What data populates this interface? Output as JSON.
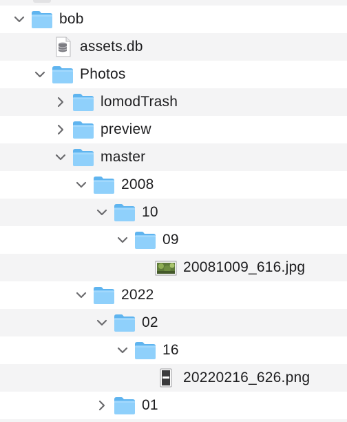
{
  "tree": [
    {
      "label": "bob",
      "type": "folder",
      "expanded": true
    },
    {
      "label": "assets.db",
      "type": "db-file"
    },
    {
      "label": "Photos",
      "type": "folder",
      "expanded": true
    },
    {
      "label": "lomodTrash",
      "type": "folder",
      "expanded": false
    },
    {
      "label": "preview",
      "type": "folder",
      "expanded": false
    },
    {
      "label": "master",
      "type": "folder",
      "expanded": true
    },
    {
      "label": "2008",
      "type": "folder",
      "expanded": true
    },
    {
      "label": "10",
      "type": "folder",
      "expanded": true
    },
    {
      "label": "09",
      "type": "folder",
      "expanded": true
    },
    {
      "label": "20081009_616.jpg",
      "type": "jpg-file"
    },
    {
      "label": "2022",
      "type": "folder",
      "expanded": true
    },
    {
      "label": "02",
      "type": "folder",
      "expanded": true
    },
    {
      "label": "16",
      "type": "folder",
      "expanded": true
    },
    {
      "label": "20220216_626.png",
      "type": "png-file"
    },
    {
      "label": "01",
      "type": "folder",
      "expanded": false
    }
  ],
  "colors": {
    "folder_back": "#5fb4ef",
    "folder_front": "#8fd0fb",
    "chevron": "#6b6b6e",
    "row_alt": "#f4f4f5"
  }
}
